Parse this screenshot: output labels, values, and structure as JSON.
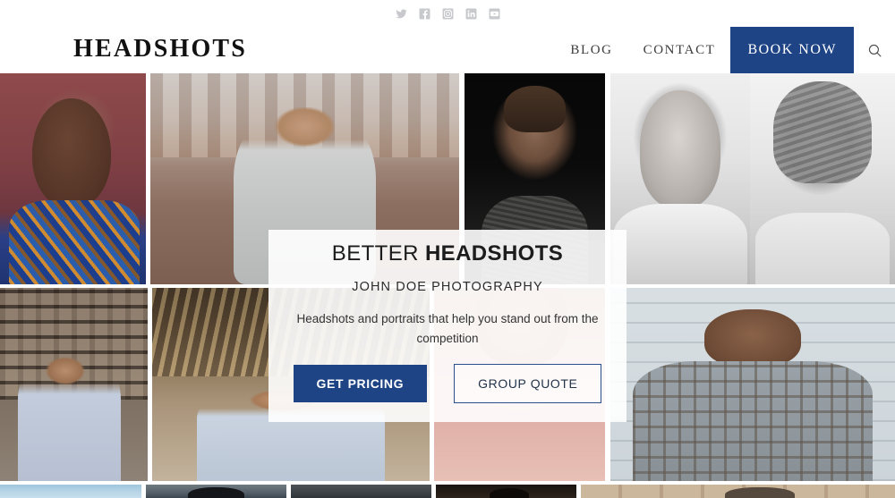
{
  "site": {
    "logo": "HEADSHOTS",
    "accent_navy": "#1f4486",
    "overlay_bg": "rgba(255,255,255,0.90)"
  },
  "social": {
    "items": [
      {
        "name": "twitter-icon",
        "label": "Twitter"
      },
      {
        "name": "facebook-icon",
        "label": "Facebook"
      },
      {
        "name": "instagram-icon",
        "label": "Instagram"
      },
      {
        "name": "linkedin-icon",
        "label": "LinkedIn"
      },
      {
        "name": "youtube-icon",
        "label": "YouTube"
      }
    ]
  },
  "nav": {
    "blog": "BLOG",
    "contact": "CONTACT",
    "book_now": "BOOK NOW",
    "search_icon": "search-icon"
  },
  "hero": {
    "title_light": "BETTER ",
    "title_bold": "HEADSHOTS",
    "subtitle": "JOHN DOE PHOTOGRAPHY",
    "description": "Headshots and portraits that help you stand out from the competition",
    "primary_button": "GET PRICING",
    "secondary_button": "GROUP QUOTE"
  },
  "gallery": {
    "row1": [
      {
        "alt": "Woman in blue patterned top on maroon backdrop"
      },
      {
        "alt": "Smiling man in grey jacket on city street"
      },
      {
        "alt": "Man in dark sweater on black background"
      },
      {
        "alt": "Black and white portrait of older bald man"
      },
      {
        "alt": "Black and white portrait of young man with long hair"
      }
    ],
    "row2": [
      {
        "alt": "Man with glasses in a shop interior"
      },
      {
        "alt": "Person in cafe interior with wooden ceiling"
      },
      {
        "alt": "Woman with necklace on pink backdrop"
      },
      {
        "alt": "Man in plaid blazer against light wall"
      }
    ],
    "row3": [
      {
        "alt": "Light blue partial thumbnail"
      },
      {
        "alt": "Dark figure partial thumbnail"
      },
      {
        "alt": "Grey partial thumbnail"
      },
      {
        "alt": "Dark brown partial thumbnail"
      },
      {
        "alt": "Beige wall partial thumbnail"
      }
    ]
  }
}
